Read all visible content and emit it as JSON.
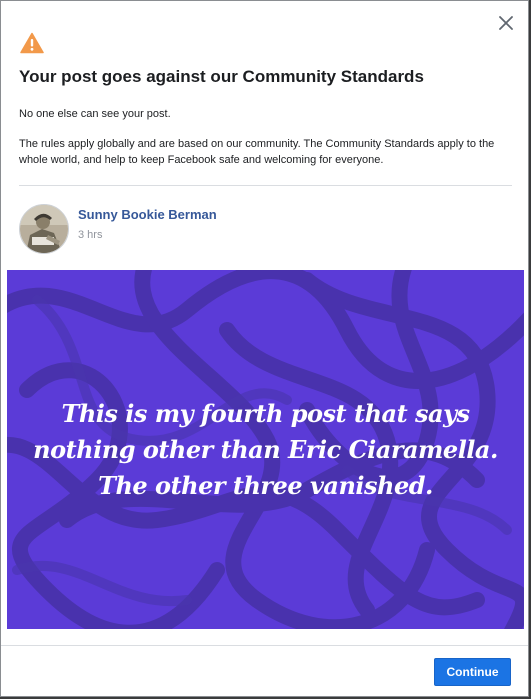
{
  "dialog": {
    "title": "Your post goes against our Community Standards",
    "visibility_note": "No one else can see your post.",
    "rules_note": "The rules apply globally and are based on our community. The Community Standards apply to the whole world, and help to keep Facebook safe and welcoming for everyone.",
    "continue_label": "Continue",
    "icons": {
      "warning": "warning-triangle-icon",
      "close": "close-icon"
    },
    "colors": {
      "warning": "#f2994a",
      "link": "#365899",
      "button": "#1b74e4",
      "post_background": "#5b3bd7"
    }
  },
  "post": {
    "author": "Sunny Bookie Berman",
    "time": "3 hrs",
    "lines": [
      "This is my fourth post that says",
      "nothing other than Eric Ciaramella.",
      "The other three vanished."
    ]
  }
}
